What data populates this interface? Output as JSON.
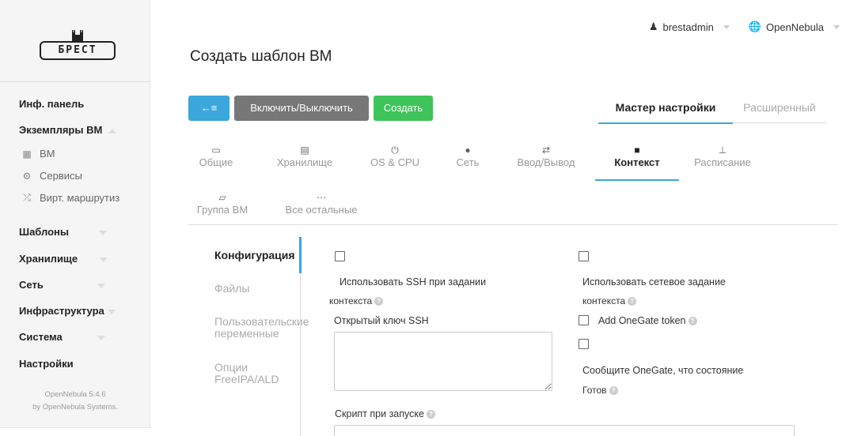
{
  "logo": {
    "text": "БРЕСТ"
  },
  "sidebar": {
    "items": [
      {
        "label": "Инф. панель"
      },
      {
        "label": "Экземпляры ВМ"
      },
      {
        "label": "ВМ",
        "icon": "grid-icon"
      },
      {
        "label": "Сервисы",
        "icon": "services-icon"
      },
      {
        "label": "Вирт. маршрутиз",
        "icon": "shuffle-icon"
      },
      {
        "label": "Шаблоны"
      },
      {
        "label": "Хранилище"
      },
      {
        "label": "Сеть"
      },
      {
        "label": "Инфраструктура"
      },
      {
        "label": "Система"
      },
      {
        "label": "Настройки"
      }
    ],
    "footer": {
      "version": "OpenNebula 5.4.6",
      "by": "by OpenNebula Systems."
    }
  },
  "userbar": {
    "user": "brestadmin",
    "zone": "OpenNebula"
  },
  "page": {
    "title": "Создать шаблон ВМ"
  },
  "toolbar": {
    "back": "←≡",
    "toggle": "Включить/Выключить",
    "create": "Создать"
  },
  "modes": {
    "wizard": "Мастер настройки",
    "advanced": "Расширенный"
  },
  "tabs": [
    {
      "label": "Общие",
      "icon": "laptop-icon"
    },
    {
      "label": "Хранилище",
      "icon": "storage-icon"
    },
    {
      "label": "OS & CPU",
      "icon": "power-icon"
    },
    {
      "label": "Сеть",
      "icon": "globe-icon"
    },
    {
      "label": "Ввод/Вывод",
      "icon": "exchange-icon"
    },
    {
      "label": "Контекст",
      "icon": "folder-icon"
    },
    {
      "label": "Расписание",
      "icon": "sitemap-icon"
    },
    {
      "label": "Группа ВМ",
      "icon": "folder-open-icon"
    },
    {
      "label": "Все остальные",
      "icon": "ellipsis-icon"
    }
  ],
  "subtabs": [
    {
      "label": "Конфигурация"
    },
    {
      "label": "Файлы"
    },
    {
      "label": "Пользовательские переменные"
    },
    {
      "label": "Опции FreeIPA/ALD"
    }
  ],
  "form": {
    "ssh_context_1": "Использовать SSH при задании",
    "ssh_context_2": "контекста",
    "ssh_key": "Открытый ключ SSH",
    "net_context_1": "Использовать сетевое задание",
    "net_context_2": "контекста",
    "onegate_token": "Add OneGate token",
    "report_ready_1": "Сообщите OneGate, что состояние",
    "report_ready_2": "Готов",
    "start_script": "Скрипт при запуске"
  }
}
